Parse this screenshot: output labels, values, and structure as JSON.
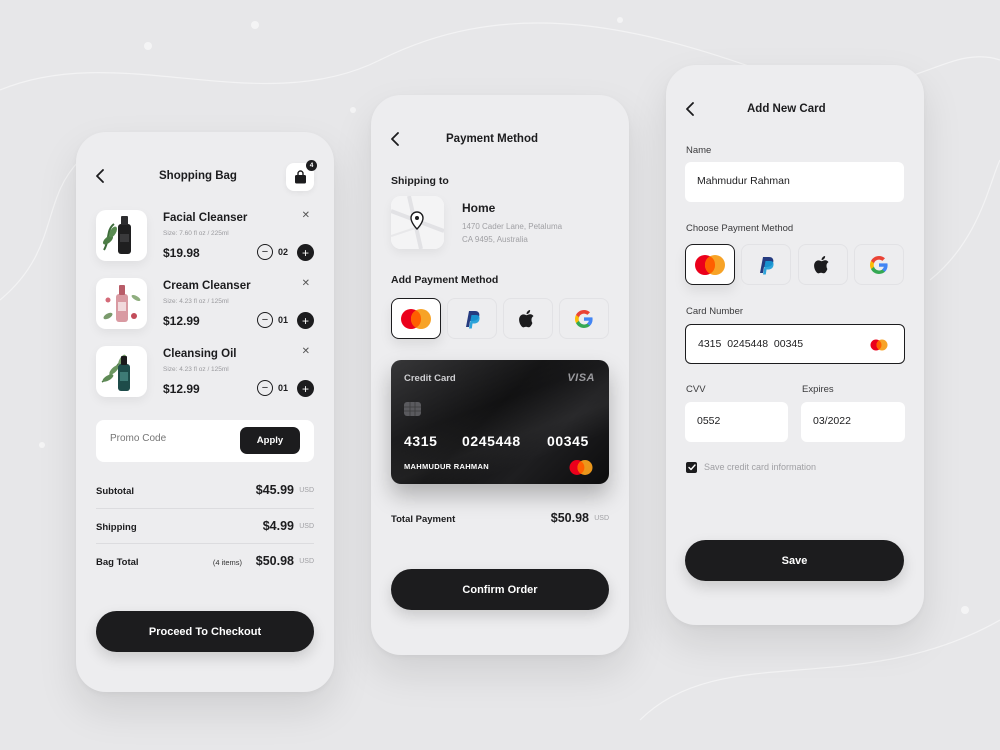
{
  "shopping_bag": {
    "title": "Shopping Bag",
    "bag_count": "4",
    "items": [
      {
        "name": "Facial Cleanser",
        "size": "Size: 7.60 fl oz / 225ml",
        "price": "$19.98",
        "qty": "02"
      },
      {
        "name": "Cream Cleanser",
        "size": "Size: 4.23 fl oz / 125ml",
        "price": "$12.99",
        "qty": "01"
      },
      {
        "name": "Cleansing Oil",
        "size": "Size: 4.23 fl oz / 125ml",
        "price": "$12.99",
        "qty": "01"
      }
    ],
    "promo_placeholder": "Promo Code",
    "apply_label": "Apply",
    "subtotal_label": "Subtotal",
    "subtotal_value": "$45.99",
    "shipping_label": "Shipping",
    "shipping_value": "$4.99",
    "bag_total_label": "Bag Total",
    "bag_total_items": "(4 items)",
    "bag_total_value": "$50.98",
    "currency": "USD",
    "checkout_label": "Proceed To Checkout"
  },
  "payment_method": {
    "title": "Payment Method",
    "shipping_to_label": "Shipping to",
    "address_title": "Home",
    "address_line1": "1470 Cader Lane, Petaluma",
    "address_line2": "CA 9495, Australia",
    "add_payment_label": "Add Payment Method",
    "methods": [
      "mastercard-icon",
      "paypal-icon",
      "apple-icon",
      "google-icon"
    ],
    "card": {
      "type": "Credit Card",
      "brand": "VISA",
      "number_parts": [
        "4315",
        "0245448",
        "00345"
      ],
      "holder": "MAHMUDUR RAHMAN"
    },
    "total_label": "Total Payment",
    "total_value": "$50.98",
    "currency": "USD",
    "confirm_label": "Confirm Order"
  },
  "add_card": {
    "title": "Add New Card",
    "name_label": "Name",
    "name_value": "Mahmudur Rahman",
    "choose_label": "Choose Payment Method",
    "card_number_label": "Card Number",
    "card_number_value": "4315  0245448  00345",
    "cvv_label": "CVV",
    "cvv_value": "0552",
    "expires_label": "Expires",
    "expires_value": "03/2022",
    "save_info_label": "Save credit card information",
    "save_label": "Save"
  },
  "colors": {
    "accent_dark": "#1c1c1e",
    "background": "#e7e7e9",
    "panel": "#ededef",
    "mastercard_red": "#eb001b",
    "mastercard_orange": "#f79e1b",
    "paypal_dark": "#253b80",
    "paypal_light": "#179bd7"
  }
}
